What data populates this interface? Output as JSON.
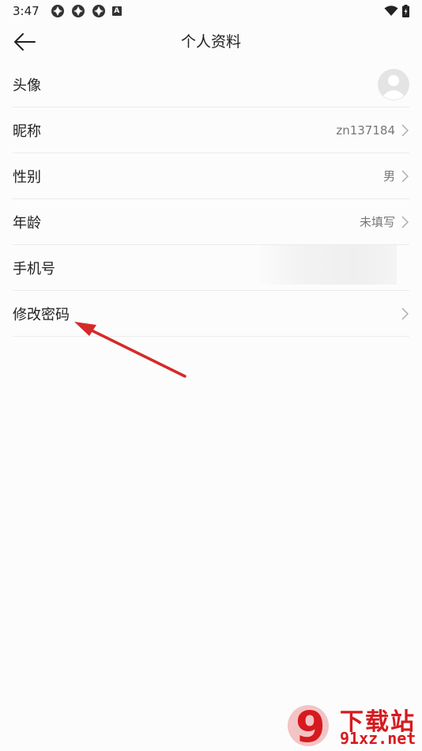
{
  "status_bar": {
    "time": "3:47",
    "left_icons": [
      "app-icon",
      "app-icon",
      "app-icon",
      "a-icon"
    ],
    "a_icon_letter": "A",
    "right_icons": [
      "wifi-icon",
      "battery-charging-icon"
    ]
  },
  "header": {
    "title": "个人资料",
    "back_icon": "back-arrow-icon"
  },
  "profile_rows": [
    {
      "label": "头像",
      "value": "",
      "type": "avatar"
    },
    {
      "label": "昵称",
      "value": "zn137184",
      "type": "chevron"
    },
    {
      "label": "性别",
      "value": "男",
      "type": "chevron"
    },
    {
      "label": "年龄",
      "value": "未填写",
      "type": "chevron"
    },
    {
      "label": "手机号",
      "value": "",
      "type": "masked"
    },
    {
      "label": "修改密码",
      "value": "",
      "type": "chevron"
    }
  ],
  "annotation": {
    "color": "#d42a2a"
  },
  "watermark": {
    "logo_text": "9",
    "title": "下载站",
    "domain": "91xz.net",
    "color": "#d61a1f"
  }
}
